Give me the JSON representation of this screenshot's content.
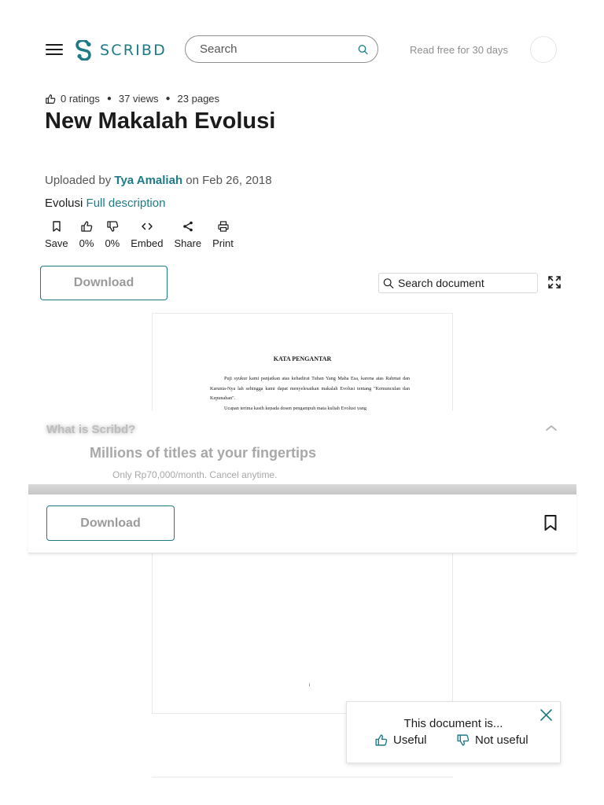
{
  "header": {
    "logo_text": "SCRIBD",
    "search_placeholder": "Search",
    "read_free": "Read free for 30 days"
  },
  "document": {
    "meta": {
      "ratings": "0 ratings",
      "views": "37 views",
      "pages": "23 pages"
    },
    "title": "New Makalah Evolusi",
    "uploaded_prefix": "Uploaded by",
    "author": "Tya Amaliah",
    "date_text": "on Feb 26, 2018",
    "category": "Evolusi",
    "full_description": "Full description"
  },
  "actions": [
    {
      "label": "Save",
      "icon": "bookmark-icon"
    },
    {
      "label": "0%",
      "icon": "thumbs-up-icon"
    },
    {
      "label": "0%",
      "icon": "thumbs-down-icon"
    },
    {
      "label": "Embed",
      "icon": "code-icon"
    },
    {
      "label": "Share",
      "icon": "share-icon"
    },
    {
      "label": "Print",
      "icon": "print-icon"
    }
  ],
  "download_label": "Download",
  "search_document_placeholder": "Search document",
  "page": {
    "heading": "KATA PENGANTAR",
    "paragraph1": "Puji syukur kami panjatkan atas kehadirat Tuhan Yang Maha Esa, karena atas Rahmat dan Karunia-Nya lah sehingga kami dapat menyelesaikan makalah Evolusi tentang \"Kemunculan dan Kepunahan\".",
    "paragraph2": "Ucapan terima kasih kepada dosen pengampuh mata kuliah Evolusi yang",
    "page_number": "i"
  },
  "promo": {
    "label": "What is Scribd?",
    "heading": "Millions of titles at your fingertips",
    "subtext": "Only Rp70,000/month. Cancel anytime."
  },
  "feedback": {
    "title": "This document is...",
    "useful": "Useful",
    "not_useful": "Not useful"
  },
  "colors": {
    "accent": "#1e7b85",
    "muted": "#a8a8a8"
  }
}
